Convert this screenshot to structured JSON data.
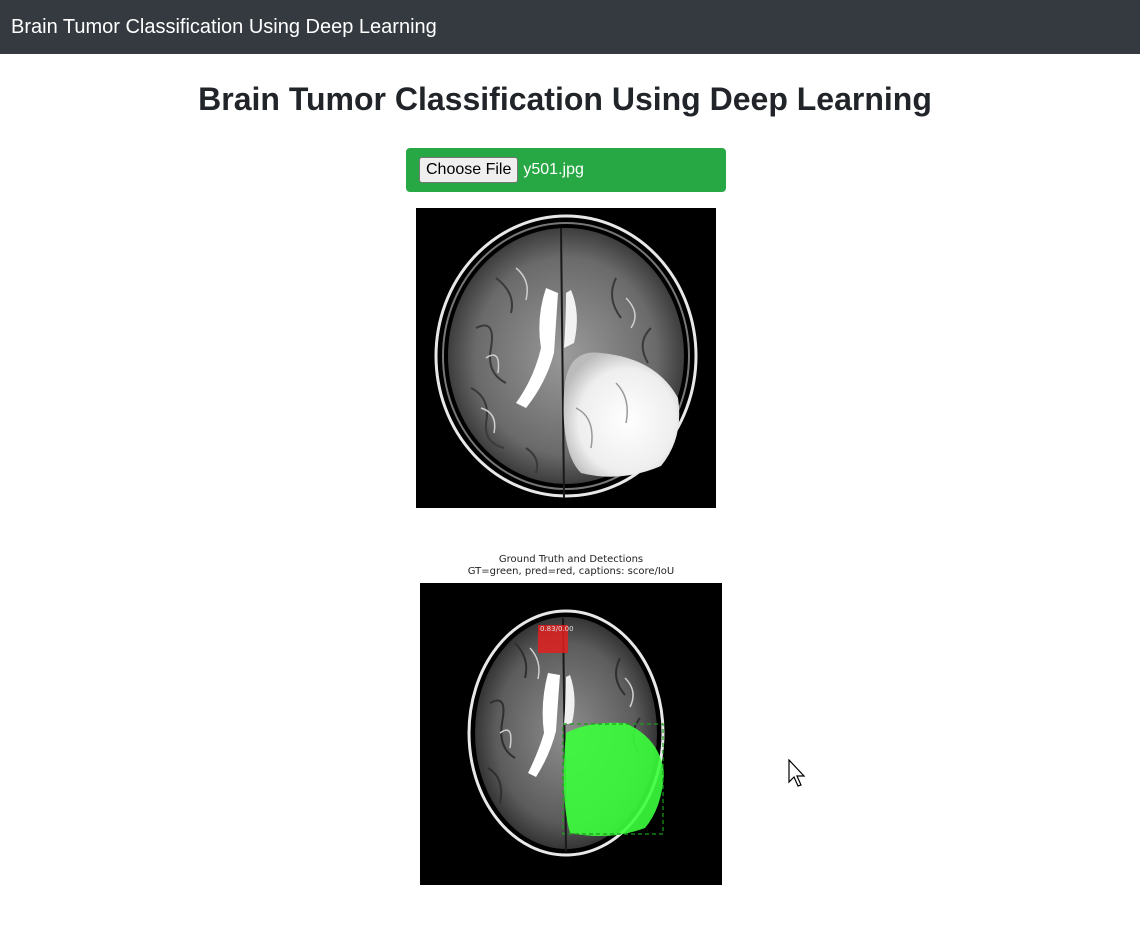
{
  "navbar": {
    "brand": "Brain Tumor Classification Using Deep Learning"
  },
  "main": {
    "title": "Brain Tumor Classification Using Deep Learning",
    "upload": {
      "button_label": "Choose File",
      "file_name": "y501.jpg"
    },
    "result_figure": {
      "title_line1": "Ground Truth and Detections",
      "title_line2": "GT=green, pred=red, captions: score/IoU",
      "detection_caption": "0.83/0.00"
    }
  },
  "colors": {
    "navbar": "#343a40",
    "upload_bg": "#28a745",
    "ground_truth": "#33ff33",
    "prediction": "#e02020"
  },
  "icons": {
    "cursor": "mouse-pointer-icon"
  }
}
